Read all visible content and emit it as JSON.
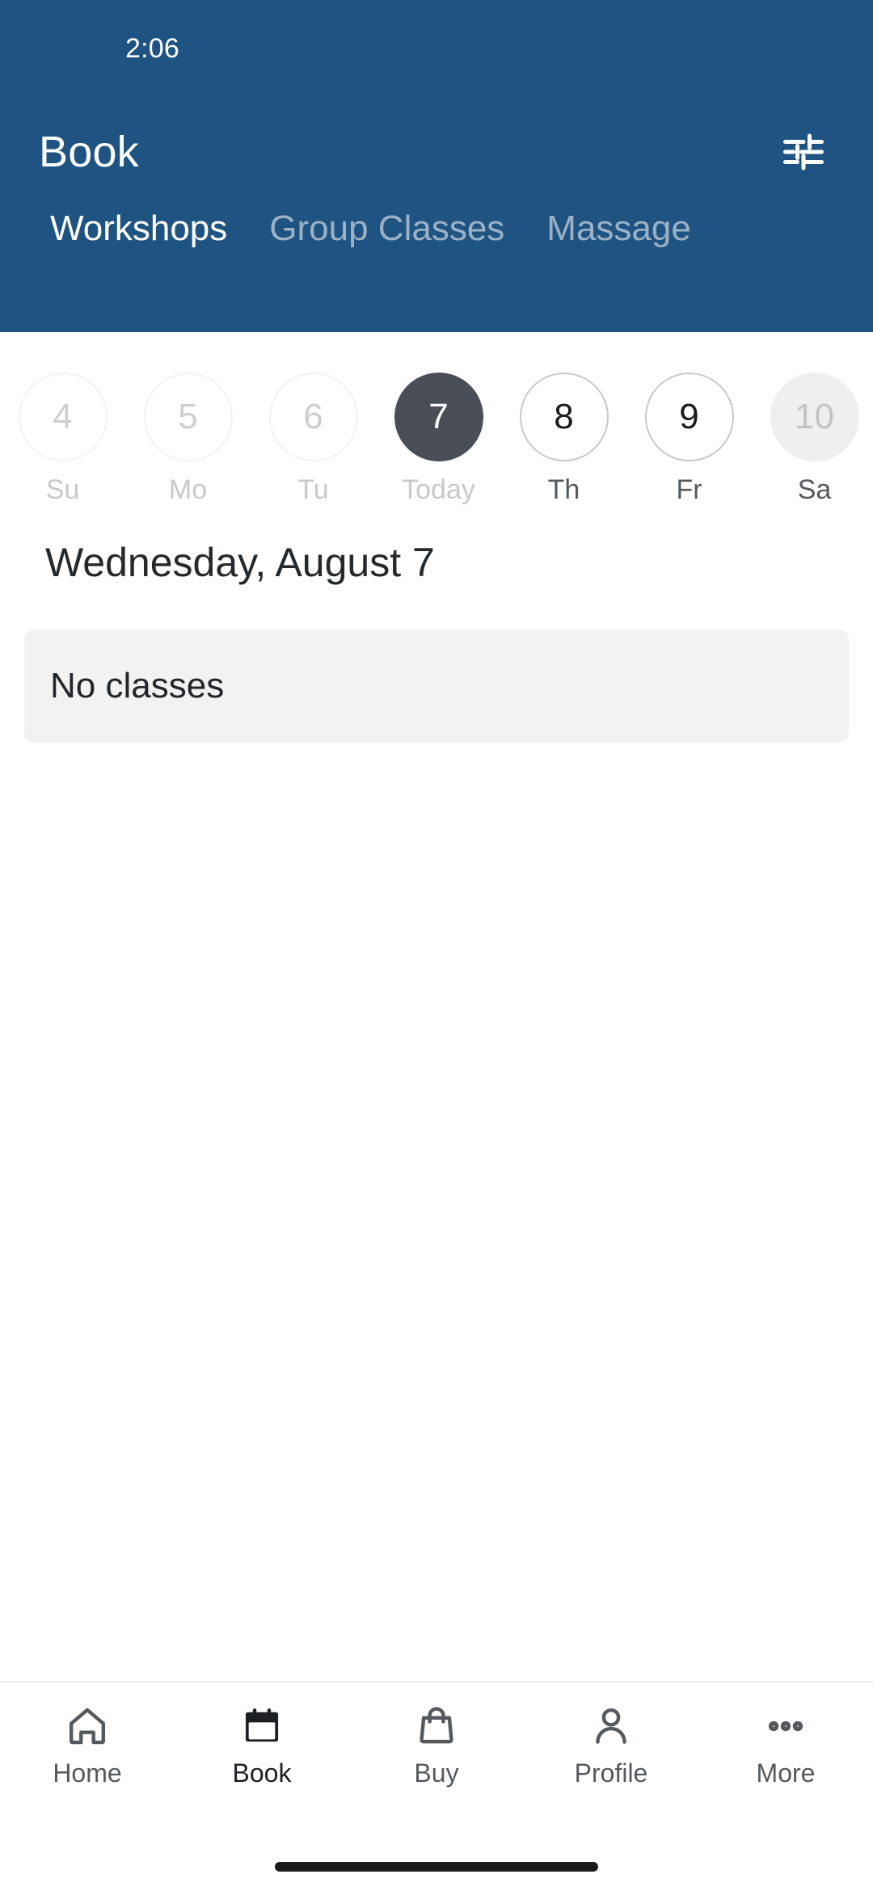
{
  "theme": {
    "header_blue": "#1f5382",
    "selected_day_bg": "#4a4e57",
    "card_bg": "#f2f2f2",
    "muted_text": "#55595e",
    "disabled_text": "#c9c9c9"
  },
  "status_bar": {
    "time": "2:06"
  },
  "header": {
    "title": "Book",
    "filter_icon": "tune-sliders-icon"
  },
  "tabs": [
    {
      "label": "Workshops",
      "active": true
    },
    {
      "label": "Group Classes",
      "active": false
    },
    {
      "label": "Massage",
      "active": false
    }
  ],
  "date_strip": [
    {
      "day_number": "4",
      "weekday": "Su",
      "state": "disabled"
    },
    {
      "day_number": "5",
      "weekday": "Mo",
      "state": "disabled"
    },
    {
      "day_number": "6",
      "weekday": "Tu",
      "state": "disabled"
    },
    {
      "day_number": "7",
      "weekday": "Today",
      "state": "selected"
    },
    {
      "day_number": "8",
      "weekday": "Th",
      "state": "selectable"
    },
    {
      "day_number": "9",
      "weekday": "Fr",
      "state": "selectable"
    },
    {
      "day_number": "10",
      "weekday": "Sa",
      "state": "filled"
    }
  ],
  "main": {
    "day_heading": "Wednesday, August 7",
    "empty_state": "No classes"
  },
  "bottom_nav": [
    {
      "label": "Home",
      "icon": "home-icon",
      "active": false
    },
    {
      "label": "Book",
      "icon": "calendar-icon",
      "active": true
    },
    {
      "label": "Buy",
      "icon": "shopping-bag-icon",
      "active": false
    },
    {
      "label": "Profile",
      "icon": "person-icon",
      "active": false
    },
    {
      "label": "More",
      "icon": "more-dots-icon",
      "active": false
    }
  ]
}
